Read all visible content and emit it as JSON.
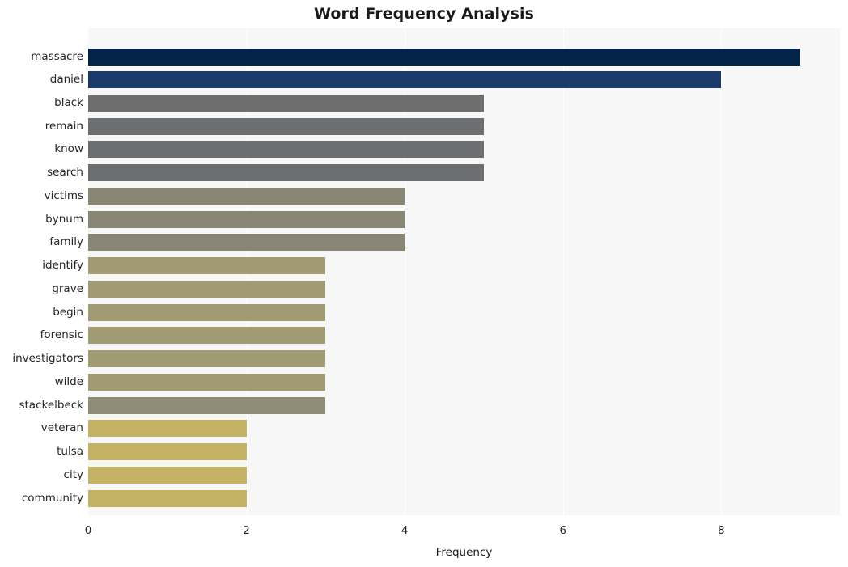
{
  "chart_data": {
    "type": "bar",
    "orientation": "horizontal",
    "title": "Word Frequency Analysis",
    "xlabel": "Frequency",
    "ylabel": "",
    "xlim": [
      0,
      9.5
    ],
    "xticks": [
      0,
      2,
      4,
      6,
      8
    ],
    "xtick_labels": [
      "0",
      "2",
      "4",
      "6",
      "8"
    ],
    "grid": true,
    "legend": null,
    "categories": [
      "massacre",
      "daniel",
      "black",
      "remain",
      "know",
      "search",
      "victims",
      "bynum",
      "family",
      "identify",
      "grave",
      "begin",
      "forensic",
      "investigators",
      "wilde",
      "stackelbeck",
      "veteran",
      "tulsa",
      "city",
      "community"
    ],
    "values": [
      9,
      8,
      5,
      5,
      5,
      5,
      4,
      4,
      4,
      3,
      3,
      3,
      3,
      3,
      3,
      3,
      2,
      2,
      2,
      2
    ],
    "bar_colors": [
      "#04234a",
      "#1b3a6b",
      "#6c6e70",
      "#6c6e70",
      "#6c6e70",
      "#6c6e70",
      "#8a8676",
      "#8a8676",
      "#8a8676",
      "#a09b72",
      "#a09b72",
      "#a09b72",
      "#a09b72",
      "#a09b72",
      "#a09b72",
      "#8f8b77",
      "#c4b264",
      "#c4b264",
      "#c4b264",
      "#c4b264"
    ],
    "plot_background": "#f7f7f7",
    "figure_background": "#ffffff",
    "gridline_color": "#ffffff"
  }
}
